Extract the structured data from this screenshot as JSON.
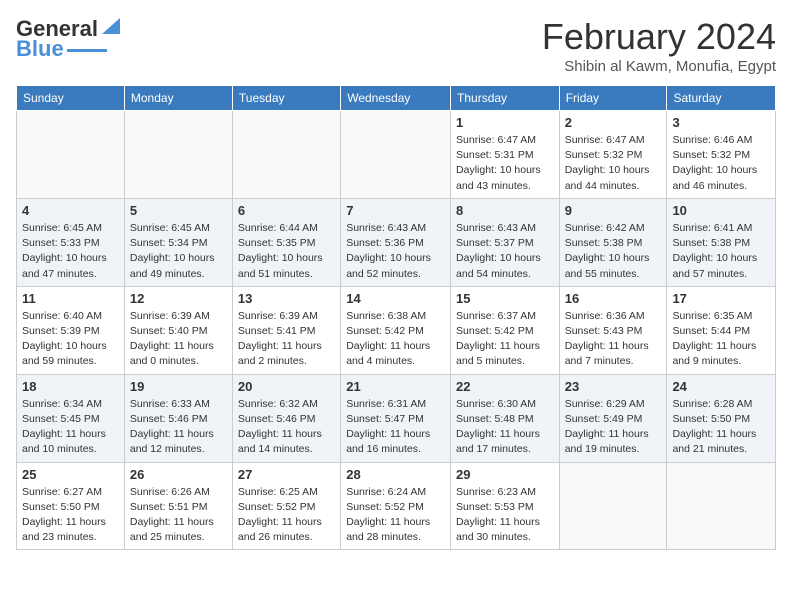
{
  "header": {
    "logo_general": "General",
    "logo_blue": "Blue",
    "month_title": "February 2024",
    "subtitle": "Shibin al Kawm, Monufia, Egypt"
  },
  "days_of_week": [
    "Sunday",
    "Monday",
    "Tuesday",
    "Wednesday",
    "Thursday",
    "Friday",
    "Saturday"
  ],
  "weeks": [
    [
      {
        "day": "",
        "info": ""
      },
      {
        "day": "",
        "info": ""
      },
      {
        "day": "",
        "info": ""
      },
      {
        "day": "",
        "info": ""
      },
      {
        "day": "1",
        "info": "Sunrise: 6:47 AM\nSunset: 5:31 PM\nDaylight: 10 hours and 43 minutes."
      },
      {
        "day": "2",
        "info": "Sunrise: 6:47 AM\nSunset: 5:32 PM\nDaylight: 10 hours and 44 minutes."
      },
      {
        "day": "3",
        "info": "Sunrise: 6:46 AM\nSunset: 5:32 PM\nDaylight: 10 hours and 46 minutes."
      }
    ],
    [
      {
        "day": "4",
        "info": "Sunrise: 6:45 AM\nSunset: 5:33 PM\nDaylight: 10 hours and 47 minutes."
      },
      {
        "day": "5",
        "info": "Sunrise: 6:45 AM\nSunset: 5:34 PM\nDaylight: 10 hours and 49 minutes."
      },
      {
        "day": "6",
        "info": "Sunrise: 6:44 AM\nSunset: 5:35 PM\nDaylight: 10 hours and 51 minutes."
      },
      {
        "day": "7",
        "info": "Sunrise: 6:43 AM\nSunset: 5:36 PM\nDaylight: 10 hours and 52 minutes."
      },
      {
        "day": "8",
        "info": "Sunrise: 6:43 AM\nSunset: 5:37 PM\nDaylight: 10 hours and 54 minutes."
      },
      {
        "day": "9",
        "info": "Sunrise: 6:42 AM\nSunset: 5:38 PM\nDaylight: 10 hours and 55 minutes."
      },
      {
        "day": "10",
        "info": "Sunrise: 6:41 AM\nSunset: 5:38 PM\nDaylight: 10 hours and 57 minutes."
      }
    ],
    [
      {
        "day": "11",
        "info": "Sunrise: 6:40 AM\nSunset: 5:39 PM\nDaylight: 10 hours and 59 minutes."
      },
      {
        "day": "12",
        "info": "Sunrise: 6:39 AM\nSunset: 5:40 PM\nDaylight: 11 hours and 0 minutes."
      },
      {
        "day": "13",
        "info": "Sunrise: 6:39 AM\nSunset: 5:41 PM\nDaylight: 11 hours and 2 minutes."
      },
      {
        "day": "14",
        "info": "Sunrise: 6:38 AM\nSunset: 5:42 PM\nDaylight: 11 hours and 4 minutes."
      },
      {
        "day": "15",
        "info": "Sunrise: 6:37 AM\nSunset: 5:42 PM\nDaylight: 11 hours and 5 minutes."
      },
      {
        "day": "16",
        "info": "Sunrise: 6:36 AM\nSunset: 5:43 PM\nDaylight: 11 hours and 7 minutes."
      },
      {
        "day": "17",
        "info": "Sunrise: 6:35 AM\nSunset: 5:44 PM\nDaylight: 11 hours and 9 minutes."
      }
    ],
    [
      {
        "day": "18",
        "info": "Sunrise: 6:34 AM\nSunset: 5:45 PM\nDaylight: 11 hours and 10 minutes."
      },
      {
        "day": "19",
        "info": "Sunrise: 6:33 AM\nSunset: 5:46 PM\nDaylight: 11 hours and 12 minutes."
      },
      {
        "day": "20",
        "info": "Sunrise: 6:32 AM\nSunset: 5:46 PM\nDaylight: 11 hours and 14 minutes."
      },
      {
        "day": "21",
        "info": "Sunrise: 6:31 AM\nSunset: 5:47 PM\nDaylight: 11 hours and 16 minutes."
      },
      {
        "day": "22",
        "info": "Sunrise: 6:30 AM\nSunset: 5:48 PM\nDaylight: 11 hours and 17 minutes."
      },
      {
        "day": "23",
        "info": "Sunrise: 6:29 AM\nSunset: 5:49 PM\nDaylight: 11 hours and 19 minutes."
      },
      {
        "day": "24",
        "info": "Sunrise: 6:28 AM\nSunset: 5:50 PM\nDaylight: 11 hours and 21 minutes."
      }
    ],
    [
      {
        "day": "25",
        "info": "Sunrise: 6:27 AM\nSunset: 5:50 PM\nDaylight: 11 hours and 23 minutes."
      },
      {
        "day": "26",
        "info": "Sunrise: 6:26 AM\nSunset: 5:51 PM\nDaylight: 11 hours and 25 minutes."
      },
      {
        "day": "27",
        "info": "Sunrise: 6:25 AM\nSunset: 5:52 PM\nDaylight: 11 hours and 26 minutes."
      },
      {
        "day": "28",
        "info": "Sunrise: 6:24 AM\nSunset: 5:52 PM\nDaylight: 11 hours and 28 minutes."
      },
      {
        "day": "29",
        "info": "Sunrise: 6:23 AM\nSunset: 5:53 PM\nDaylight: 11 hours and 30 minutes."
      },
      {
        "day": "",
        "info": ""
      },
      {
        "day": "",
        "info": ""
      }
    ]
  ]
}
